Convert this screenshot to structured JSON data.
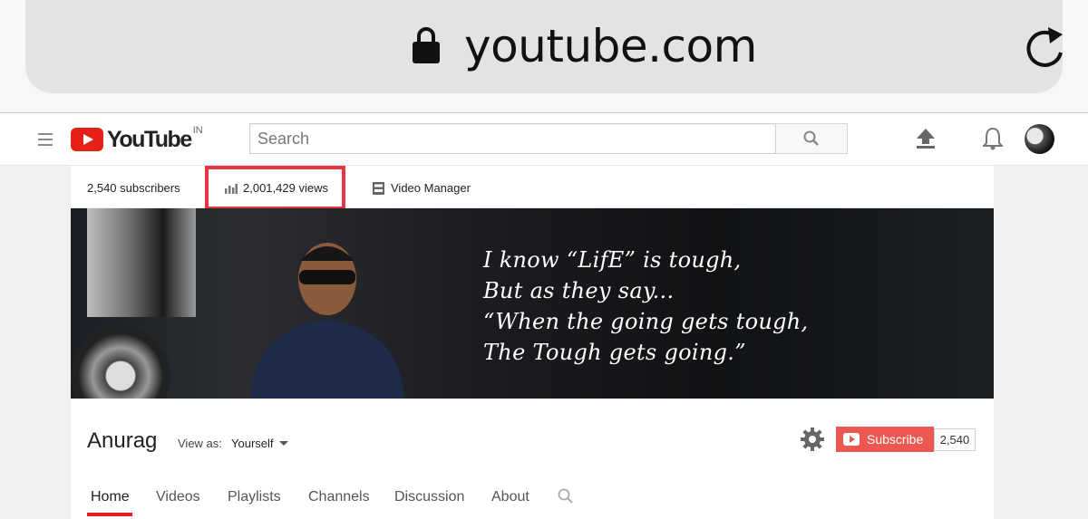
{
  "browser": {
    "url": "youtube.com"
  },
  "masthead": {
    "logo_text": "YouTube",
    "logo_region": "IN",
    "search_placeholder": "Search"
  },
  "stats": {
    "subscribers": "2,540 subscribers",
    "views": "2,001,429 views",
    "video_manager": "Video Manager"
  },
  "banner": {
    "quote_lines": [
      "I know “LifE” is tough,",
      "But as they say...",
      "“When the going gets tough,",
      "The Tough gets going.”"
    ]
  },
  "channel": {
    "name": "Anurag",
    "view_as_label": "View as:",
    "view_as_value": "Yourself",
    "subscribe_label": "Subscribe",
    "subscriber_count": "2,540"
  },
  "tabs": [
    {
      "label": "Home",
      "active": true
    },
    {
      "label": "Videos",
      "active": false
    },
    {
      "label": "Playlists",
      "active": false
    },
    {
      "label": "Channels",
      "active": false
    },
    {
      "label": "Discussion",
      "active": false
    },
    {
      "label": "About",
      "active": false
    }
  ],
  "colors": {
    "brand_red": "#e62117",
    "highlight_red": "#e8353f"
  },
  "icons": [
    "lock-icon",
    "reload-icon",
    "menu-icon",
    "search-icon",
    "upload-icon",
    "bell-icon",
    "bar-chart-icon",
    "video-manager-icon",
    "gear-icon",
    "play-icon"
  ]
}
